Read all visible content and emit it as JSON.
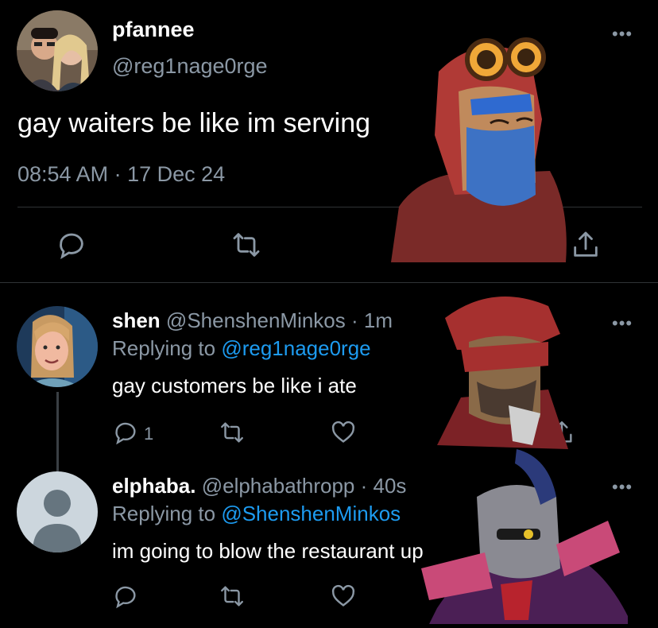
{
  "main_tweet": {
    "display_name": "pfannee",
    "handle": "@reg1nage0rge",
    "text": "gay waiters be like im serving",
    "timestamp": "08:54 AM · 17 Dec 24"
  },
  "replies": [
    {
      "display_name": "shen",
      "handle": "@ShenshenMinkos",
      "age": "· 1m",
      "replying_prefix": "Replying to",
      "replying_to": "@reg1nage0rge",
      "text": "gay customers be like i ate",
      "reply_count": "1"
    },
    {
      "display_name": "elphaba.",
      "handle": "@elphabathropp",
      "age": "· 40s",
      "replying_prefix": "Replying to",
      "replying_to": "@ShenshenMinkos",
      "text": "im going to blow the restaurant up"
    }
  ],
  "colors": {
    "background": "#000000",
    "text": "#e7e9ea",
    "muted": "#8b98a5",
    "link": "#1d9bf0",
    "divider": "#2f3336"
  },
  "icons": [
    "reply-icon",
    "retweet-icon",
    "like-icon",
    "share-icon",
    "more-icon",
    "analytics-icon"
  ]
}
